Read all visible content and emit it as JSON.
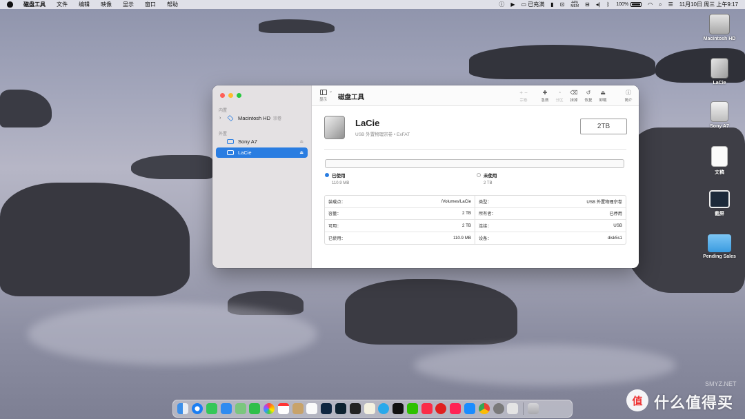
{
  "menubar": {
    "app_name": "磁盘工具",
    "menus": [
      "文件",
      "编辑",
      "映像",
      "显示",
      "窗口",
      "帮助"
    ],
    "status": {
      "charge_label": "已充满",
      "memory_percent": "44%",
      "memory_label": "MEM",
      "battery_percent": "100%",
      "datetime": "11月10日 周三 上午9:17"
    }
  },
  "desktop_icons": [
    {
      "label": "Macintosh HD",
      "icon": "hard-drive-icon"
    },
    {
      "label": "LaCie",
      "icon": "external-drive-icon"
    },
    {
      "label": "Sony A7",
      "icon": "sd-card-icon"
    },
    {
      "label": "文稿",
      "icon": "document-icon"
    },
    {
      "label": "截屏",
      "icon": "screenshot-icon"
    },
    {
      "label": "Pending Sales",
      "icon": "folder-icon"
    }
  ],
  "window": {
    "sidebar": {
      "section_internal": "内置",
      "section_external": "外置",
      "items": [
        {
          "label": "Macintosh HD",
          "tag": "宗卷"
        },
        {
          "label": "Sony A7"
        },
        {
          "label": "LaCie"
        }
      ]
    },
    "toolbar": {
      "view_label": "显示",
      "title": "磁盘工具",
      "buttons": [
        {
          "glyph": "+  −",
          "label": "宗卷",
          "enabled": false
        },
        {
          "glyph": "✚",
          "label": "急救",
          "enabled": true
        },
        {
          "glyph": "◔",
          "label": "分区",
          "enabled": false
        },
        {
          "glyph": "⌫",
          "label": "抹掉",
          "enabled": true
        },
        {
          "glyph": "↺",
          "label": "恢复",
          "enabled": true
        },
        {
          "glyph": "⏏",
          "label": "卸载",
          "enabled": true
        },
        {
          "glyph": "ⓘ",
          "label": "简介",
          "enabled": true
        }
      ]
    },
    "disk": {
      "name": "LaCie",
      "subtitle": "USB 外置物理宗卷 • ExFAT",
      "capacity": "2TB",
      "used_fraction": 0.0001
    },
    "legend": {
      "used_label": "已使用",
      "used_value": "110.9 MB",
      "free_label": "未使用",
      "free_value": "2 TB",
      "used_color": "#2a7de1",
      "free_color": "#ffffff"
    },
    "info": [
      {
        "k": "装载点：",
        "v": "/Volumes/LaCie"
      },
      {
        "k": "类型：",
        "v": "USB 外置物理宗卷"
      },
      {
        "k": "容量：",
        "v": "2 TB"
      },
      {
        "k": "所有者：",
        "v": "已停用"
      },
      {
        "k": "可用：",
        "v": "2 TB"
      },
      {
        "k": "连接：",
        "v": "USB"
      },
      {
        "k": "已使用：",
        "v": "110.9 MB"
      },
      {
        "k": "设备：",
        "v": "disk5s1"
      }
    ]
  },
  "watermark": {
    "logo_char": "值",
    "text": "什么值得买",
    "small": "SMYZ.NET"
  },
  "colors": {
    "accent": "#2a7de1",
    "close": "#fe5f57",
    "minimize": "#febc2e",
    "maximize": "#28c840"
  }
}
